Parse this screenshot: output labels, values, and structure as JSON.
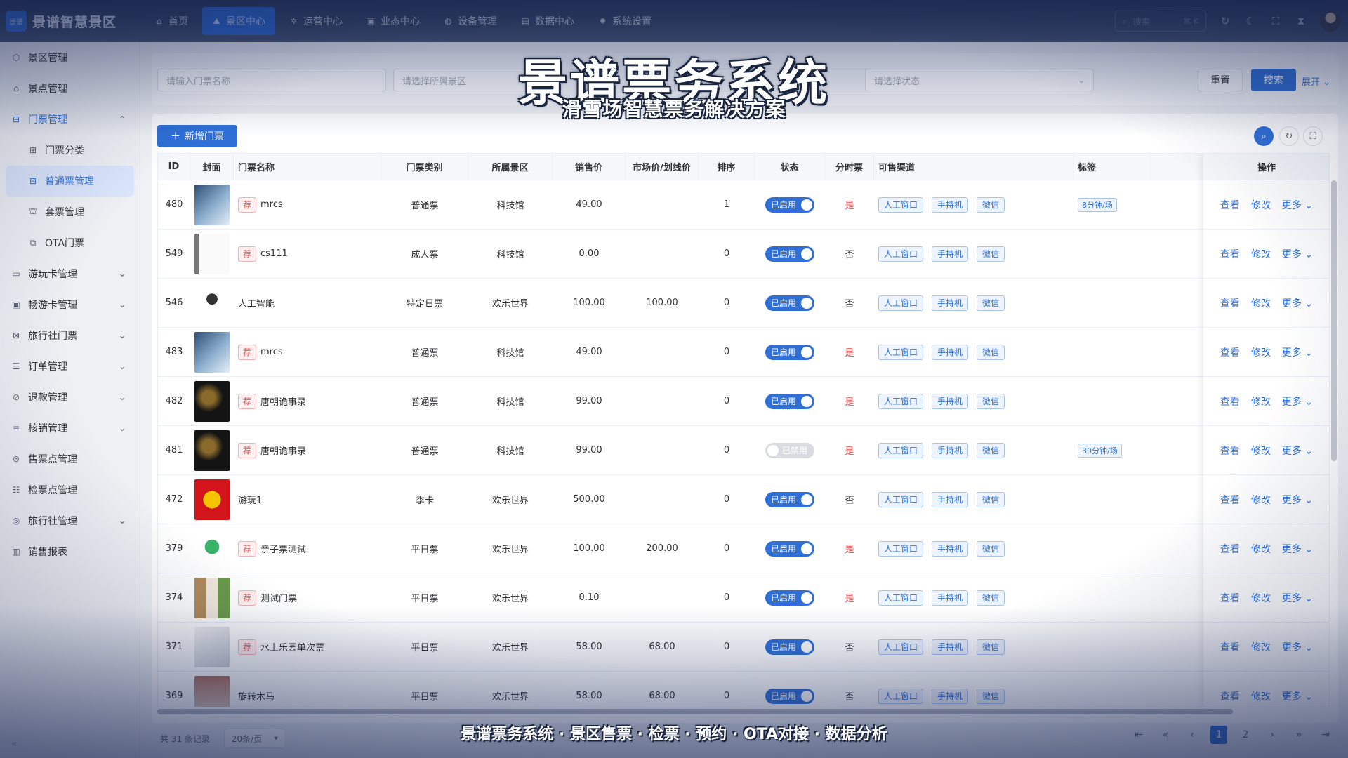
{
  "app": {
    "logo_text": "景谱智慧景区",
    "logo_badge": "景谱"
  },
  "topnav": [
    {
      "label": "首页",
      "icon": "home-icon",
      "glyph": "⌂"
    },
    {
      "label": "景区中心",
      "icon": "map-icon",
      "glyph": "⛰"
    },
    {
      "label": "运营中心",
      "icon": "gear-icon",
      "glyph": "✲"
    },
    {
      "label": "业态中心",
      "icon": "box-icon",
      "glyph": "▣"
    },
    {
      "label": "设备管理",
      "icon": "device-icon",
      "glyph": "◍"
    },
    {
      "label": "数据中心",
      "icon": "chart-icon",
      "glyph": "▤"
    },
    {
      "label": "系统设置",
      "icon": "settings-icon",
      "glyph": "✹"
    }
  ],
  "topright": {
    "search_placeholder": "搜索",
    "shortcut": "⌘ K"
  },
  "sidebar": {
    "items": [
      {
        "label": "景区管理",
        "icon": "cube-icon",
        "glyph": "⬡",
        "chev": ""
      },
      {
        "label": "景点管理",
        "icon": "house-icon",
        "glyph": "⌂",
        "chev": ""
      },
      {
        "label": "门票管理",
        "icon": "ticket-icon",
        "glyph": "⊟",
        "chev": "⌃"
      },
      {
        "label": "门票分类",
        "icon": "grid-icon",
        "glyph": "⊞",
        "chev": ""
      },
      {
        "label": "普通票管理",
        "icon": "ticket-icon",
        "glyph": "⊟",
        "chev": ""
      },
      {
        "label": "套票管理",
        "icon": "bundle-icon",
        "glyph": "⛫",
        "chev": ""
      },
      {
        "label": "OTA门票",
        "icon": "copy-icon",
        "glyph": "⧉",
        "chev": ""
      },
      {
        "label": "游玩卡管理",
        "icon": "card-icon",
        "glyph": "▭",
        "chev": "⌄"
      },
      {
        "label": "畅游卡管理",
        "icon": "card-icon",
        "glyph": "▣",
        "chev": "⌄"
      },
      {
        "label": "旅行社门票",
        "icon": "ticket-icon",
        "glyph": "⊠",
        "chev": "⌄"
      },
      {
        "label": "订单管理",
        "icon": "order-icon",
        "glyph": "☰",
        "chev": "⌄"
      },
      {
        "label": "退款管理",
        "icon": "refund-icon",
        "glyph": "⊘",
        "chev": "⌄"
      },
      {
        "label": "核销管理",
        "icon": "verify-icon",
        "glyph": "≡",
        "chev": "⌄"
      },
      {
        "label": "售票点管理",
        "icon": "pos-icon",
        "glyph": "⊜",
        "chev": ""
      },
      {
        "label": "检票点管理",
        "icon": "gate-icon",
        "glyph": "☷",
        "chev": ""
      },
      {
        "label": "旅行社管理",
        "icon": "globe-icon",
        "glyph": "◎",
        "chev": "⌄"
      },
      {
        "label": "销售报表",
        "icon": "report-icon",
        "glyph": "▥",
        "chev": ""
      }
    ]
  },
  "filters": {
    "name_placeholder": "请输入门票名称",
    "scenic_placeholder": "请选择所属景区",
    "status_placeholder": "请选择状态",
    "reset_label": "重置",
    "search_label": "搜索",
    "expand_label": "展开"
  },
  "toolbar": {
    "add_label": "新增门票"
  },
  "table": {
    "headers": [
      "ID",
      "封面",
      "门票名称",
      "门票类别",
      "所属景区",
      "销售价",
      "市场价/划线价",
      "排序",
      "状态",
      "分时票",
      "可售渠道",
      "标签",
      "操作"
    ],
    "rec_label": "荐",
    "channels": [
      "人工窗口",
      "手持机",
      "微信"
    ],
    "actions": {
      "view": "查看",
      "edit": "修改",
      "more": "更多"
    },
    "rows": [
      {
        "id": "480",
        "cover": "tech",
        "rec": true,
        "name": "mrcs",
        "type": "普通票",
        "scenic": "科技馆",
        "price": "49.00",
        "market": "",
        "sort": "1",
        "status": "已启用",
        "on": true,
        "timed": "是",
        "label": "8分钟/场"
      },
      {
        "id": "549",
        "cover": "doc",
        "rec": true,
        "name": "cs111",
        "type": "成人票",
        "scenic": "科技馆",
        "price": "0.00",
        "market": "",
        "sort": "0",
        "status": "已启用",
        "on": true,
        "timed": "否",
        "label": ""
      },
      {
        "id": "546",
        "cover": "device",
        "rec": false,
        "name": "人工智能",
        "type": "特定日票",
        "scenic": "欢乐世界",
        "price": "100.00",
        "market": "100.00",
        "sort": "0",
        "status": "已启用",
        "on": true,
        "timed": "否",
        "label": ""
      },
      {
        "id": "483",
        "cover": "tech",
        "rec": true,
        "name": "mrcs",
        "type": "普通票",
        "scenic": "科技馆",
        "price": "49.00",
        "market": "",
        "sort": "0",
        "status": "已启用",
        "on": true,
        "timed": "是",
        "label": ""
      },
      {
        "id": "482",
        "cover": "dark",
        "rec": true,
        "name": "唐朝诡事录",
        "type": "普通票",
        "scenic": "科技馆",
        "price": "99.00",
        "market": "",
        "sort": "0",
        "status": "已启用",
        "on": true,
        "timed": "是",
        "label": ""
      },
      {
        "id": "481",
        "cover": "dark",
        "rec": true,
        "name": "唐朝诡事录",
        "type": "普通票",
        "scenic": "科技馆",
        "price": "99.00",
        "market": "",
        "sort": "0",
        "status": "已禁用",
        "on": false,
        "timed": "是",
        "label": "30分钟/场"
      },
      {
        "id": "472",
        "cover": "red",
        "rec": false,
        "name": "游玩1",
        "type": "季卡",
        "scenic": "欢乐世界",
        "price": "500.00",
        "market": "",
        "sort": "0",
        "status": "已启用",
        "on": true,
        "timed": "否",
        "label": ""
      },
      {
        "id": "379",
        "cover": "green",
        "rec": true,
        "name": "亲子票测试",
        "type": "平日票",
        "scenic": "欢乐世界",
        "price": "100.00",
        "market": "200.00",
        "sort": "0",
        "status": "已启用",
        "on": true,
        "timed": "是",
        "label": ""
      },
      {
        "id": "374",
        "cover": "collage",
        "rec": true,
        "name": "测试门票",
        "type": "平日票",
        "scenic": "欢乐世界",
        "price": "0.10",
        "market": "",
        "sort": "0",
        "status": "已启用",
        "on": true,
        "timed": "是",
        "label": ""
      },
      {
        "id": "371",
        "cover": "machine",
        "rec": true,
        "name": "水上乐园单次票",
        "type": "平日票",
        "scenic": "欢乐世界",
        "price": "58.00",
        "market": "68.00",
        "sort": "0",
        "status": "已启用",
        "on": true,
        "timed": "否",
        "label": ""
      },
      {
        "id": "369",
        "cover": "carousel",
        "rec": false,
        "name": "旋转木马",
        "type": "平日票",
        "scenic": "欢乐世界",
        "price": "58.00",
        "market": "68.00",
        "sort": "0",
        "status": "已启用",
        "on": true,
        "timed": "否",
        "label": ""
      }
    ]
  },
  "footer": {
    "total": "共 31 条记录",
    "page_size": "20条/页",
    "pages": [
      "1",
      "2"
    ],
    "current_page": "1"
  },
  "captions": {
    "title": "景谱票务系统",
    "subtitle": "滑雪场智慧票务解决方案",
    "bottom": "景谱票务系统 · 景区售票 · 检票 · 预约 · OTA对接 · 数据分析"
  },
  "colors": {
    "primary": "#2f6fd6",
    "danger": "#e34d4d",
    "topbar": "#27324d"
  }
}
